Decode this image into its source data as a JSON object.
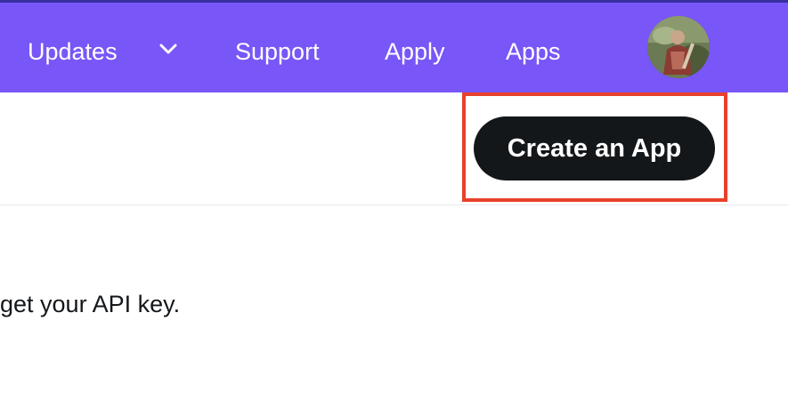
{
  "navbar": {
    "background": "#7856f7",
    "items": [
      {
        "label": "Updates",
        "has_dropdown": true
      },
      {
        "label": "Support"
      },
      {
        "label": "Apply"
      },
      {
        "label": "Apps"
      }
    ],
    "avatar_icon": "user-avatar-photo"
  },
  "toolbar": {
    "create_app_label": "Create an App",
    "button_color": "#14171a",
    "highlight_color": "#e8412b"
  },
  "content": {
    "intro_text": "get your API key."
  }
}
